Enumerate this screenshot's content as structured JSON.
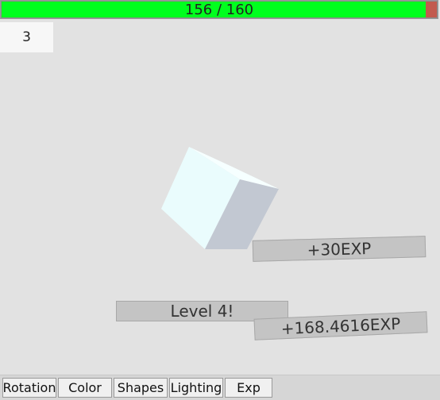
{
  "hud": {
    "hp_text": "156 / 160",
    "hp_current": 156,
    "hp_max": 160,
    "counter": "3"
  },
  "scene": {
    "object": "cube",
    "cube_colors": {
      "top": "#f6ffff",
      "left": "#eafcfd",
      "right": "#c2c8d2"
    }
  },
  "popups": {
    "exp_small": "+30EXP",
    "level_up": "Level 4!",
    "exp_large": "+168.4616EXP"
  },
  "toolbar": {
    "rotation": "Rotation",
    "color": "Color",
    "shapes": "Shapes",
    "lighting": "Lighting",
    "exp": "Exp"
  },
  "colors": {
    "hp_fill": "#00ff1e",
    "hp_remaining": "#c25a4e",
    "background": "#e2e2e2"
  }
}
